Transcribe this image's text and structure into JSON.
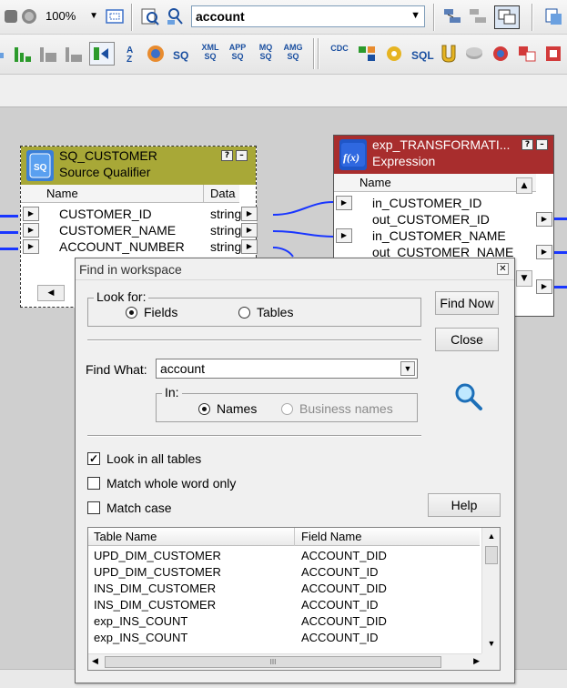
{
  "toolbar_top": {
    "zoom": "100%",
    "search_value": "account",
    "icons": [
      "hand-tool-icon",
      "zoom-icon",
      "fit-window-icon",
      "find-icon",
      "find-in-workspace-icon",
      "toolbar-icon-a",
      "toolbar-icon-b",
      "toolbar-icon-c",
      "toolbar-icon-d"
    ]
  },
  "toolbar_second": {
    "labels": {
      "sq": "SQ",
      "xml": [
        "XML",
        "SQ"
      ],
      "app": [
        "APP",
        "SQ"
      ],
      "mq": [
        "MQ",
        "SQ"
      ],
      "amg": [
        "AMG",
        "SQ"
      ],
      "cdc": [
        "CDC"
      ],
      "sql": "SQL"
    }
  },
  "sq_customer": {
    "title": "SQ_CUSTOMER",
    "subtitle": "Source Qualifier",
    "col_name": "Name",
    "col_data": "Data",
    "rows": [
      {
        "name": "CUSTOMER_ID",
        "type": "string"
      },
      {
        "name": "CUSTOMER_NAME",
        "type": "string"
      },
      {
        "name": "ACCOUNT_NUMBER",
        "type": "string"
      }
    ],
    "btn_help": "?",
    "btn_min": "–"
  },
  "exp_transform": {
    "title": "exp_TRANSFORMATI...",
    "subtitle": "Expression",
    "col_name": "Name",
    "rows": [
      "in_CUSTOMER_ID",
      "out_CUSTOMER_ID",
      "in_CUSTOMER_NAME",
      "out_CUSTOMER_NAME"
    ],
    "btn_help": "?",
    "btn_min": "–"
  },
  "dialog": {
    "title": "Find in workspace",
    "look_for_label": "Look for:",
    "fields_label": "Fields",
    "tables_label": "Tables",
    "find_what_label": "Find What:",
    "find_what_value": "account",
    "in_label": "In:",
    "names_label": "Names",
    "business_names_label": "Business names",
    "look_all_tables": "Look in all tables",
    "match_whole_word": "Match whole word only",
    "match_case": "Match case",
    "find_now": "Find Now",
    "close": "Close",
    "help": "Help",
    "results_headers": [
      "Table Name",
      "Field Name"
    ],
    "results": [
      [
        "UPD_DIM_CUSTOMER",
        "ACCOUNT_DID"
      ],
      [
        "UPD_DIM_CUSTOMER",
        "ACCOUNT_ID"
      ],
      [
        "INS_DIM_CUSTOMER",
        "ACCOUNT_DID"
      ],
      [
        "INS_DIM_CUSTOMER",
        "ACCOUNT_ID"
      ],
      [
        "exp_INS_COUNT",
        "ACCOUNT_DID"
      ],
      [
        "exp_INS_COUNT",
        "ACCOUNT_ID"
      ]
    ],
    "scroll_up": "▲",
    "scroll_down": "▼",
    "scroll_grip": "III"
  },
  "colors": {
    "link_blue": "#1936ff",
    "sq_header": "#a8a837",
    "exp_header": "#a82d2d",
    "canvas": "#cfcfcf"
  }
}
